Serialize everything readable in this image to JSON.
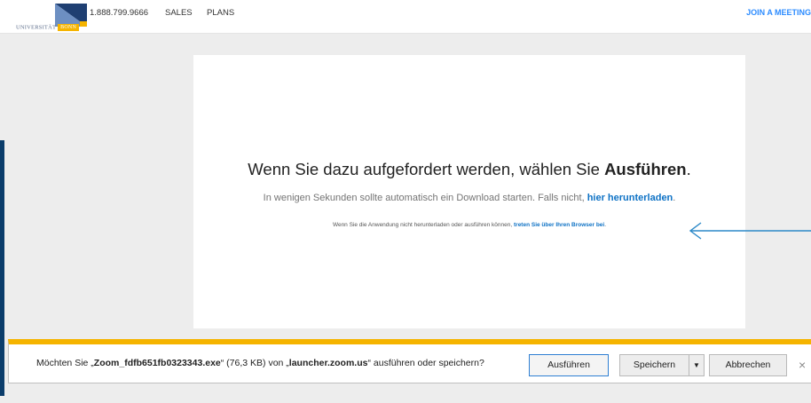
{
  "topbar": {
    "logo": {
      "university_text": "UNIVERSITÄT",
      "badge_text": "BONN",
      "colors": {
        "navy": "#1f3f72",
        "light_blue": "#6d8fc2",
        "yellow": "#f5b400"
      }
    },
    "phone": "1.888.799.9666",
    "sales": "SALES",
    "plans": "PLANS",
    "join": "JOIN A MEETING"
  },
  "card": {
    "headline_prefix": "Wenn Sie dazu aufgefordert werden, wählen Sie ",
    "headline_bold": "Ausführen",
    "headline_suffix": ".",
    "sub_prefix": "In wenigen Sekunden sollte automatisch ein Download starten. Falls nicht, ",
    "sub_link": "hier herunterladen",
    "sub_suffix": ".",
    "small_prefix": "Wenn Sie die Anwendung nicht herunterladen oder ausführen können, ",
    "small_link": "treten Sie über Ihren Browser bei",
    "small_suffix": "."
  },
  "download_bar": {
    "msg_prefix": "Möchten Sie „",
    "filename": "Zoom_fdfb651fb0323343.exe",
    "msg_middle": "“ (76,3 KB) von „",
    "source": "launcher.zoom.us",
    "msg_suffix": "“ ausführen oder speichern?",
    "run_label": "Ausführen",
    "save_label": "Speichern",
    "save_menu_glyph": "▼",
    "cancel_label": "Abbrechen",
    "close_glyph": "×",
    "accent_color": "#f5b400"
  },
  "icons": {
    "logo": "university-logo-icon",
    "arrow": "arrow-left-icon",
    "dropdown": "chevron-down-icon",
    "close": "close-icon"
  }
}
